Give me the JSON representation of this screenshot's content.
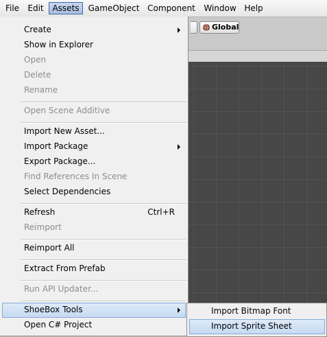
{
  "menubar": {
    "items": [
      "File",
      "Edit",
      "Assets",
      "GameObject",
      "Component",
      "Window",
      "Help"
    ],
    "active": "Assets"
  },
  "toolbar": {
    "global_label": "Global"
  },
  "assets_menu": {
    "create": "Create",
    "show_in_explorer": "Show in Explorer",
    "open": "Open",
    "delete": "Delete",
    "rename": "Rename",
    "open_scene_additive": "Open Scene Additive",
    "import_new_asset": "Import New Asset...",
    "import_package": "Import Package",
    "export_package": "Export Package...",
    "find_references": "Find References In Scene",
    "select_dependencies": "Select Dependencies",
    "refresh": "Refresh",
    "refresh_shortcut": "Ctrl+R",
    "reimport": "Reimport",
    "reimport_all": "Reimport All",
    "extract_from_prefab": "Extract From Prefab",
    "run_api_updater": "Run API Updater...",
    "shoebox_tools": "ShoeBox Tools",
    "open_csharp_project": "Open C# Project"
  },
  "shoebox_submenu": {
    "import_bitmap_font": "Import Bitmap Font",
    "import_sprite_sheet": "Import Sprite Sheet"
  }
}
